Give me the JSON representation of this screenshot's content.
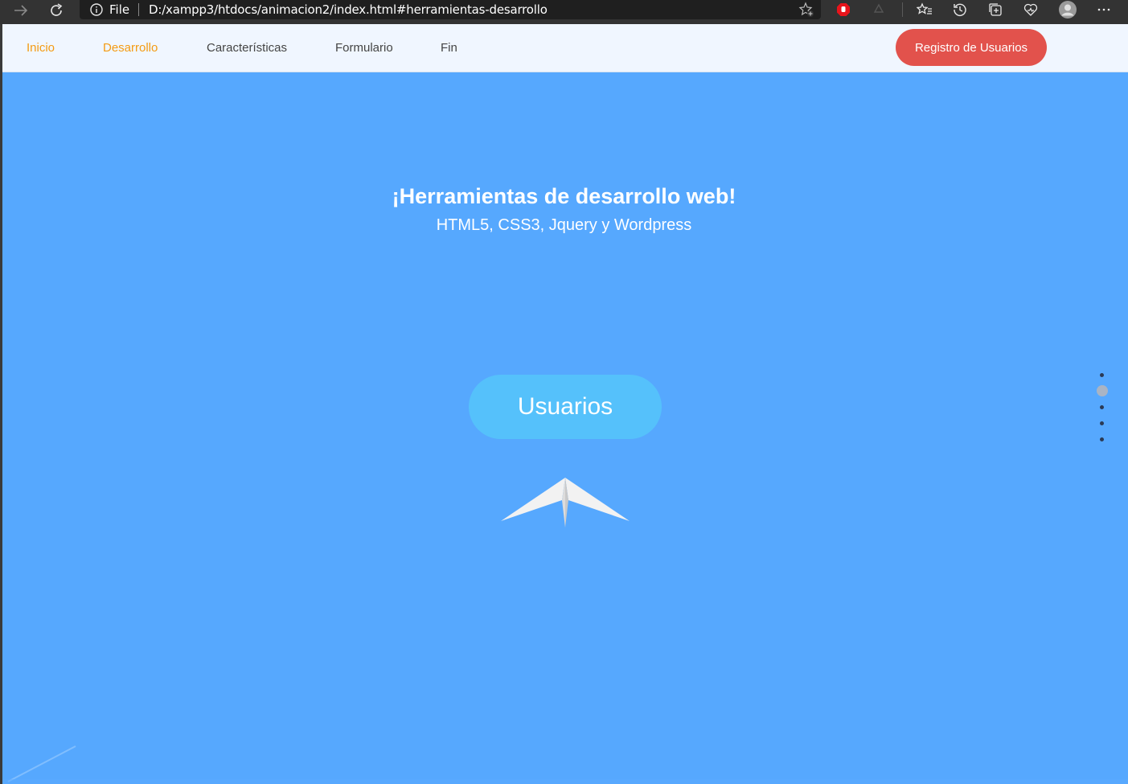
{
  "browser": {
    "scheme_label": "File",
    "url": "D:/xampp3/htdocs/animacion2/index.html#herramientas-desarrollo"
  },
  "navbar": {
    "links": [
      {
        "label": "Inicio",
        "active": true
      },
      {
        "label": "Desarrollo",
        "active": true
      },
      {
        "label": "Características",
        "active": false
      },
      {
        "label": "Formulario",
        "active": false
      },
      {
        "label": "Fin",
        "active": false
      }
    ],
    "register_label": "Registro de Usuarios"
  },
  "hero": {
    "title": "¡Herramientas de desarrollo web!",
    "subtitle": "HTML5, CSS3, Jquery y Wordpress",
    "button_label": "Usuarios",
    "icon": "paper-plane-icon"
  },
  "side_nav": {
    "dot_count": 5,
    "active_index": 1
  },
  "colors": {
    "background": "#56a8fe",
    "accent_orange": "#f49b13",
    "register_red": "#e2524c",
    "button_light_blue": "#55c1fb",
    "navbar_bg": "#f0f6ff"
  }
}
